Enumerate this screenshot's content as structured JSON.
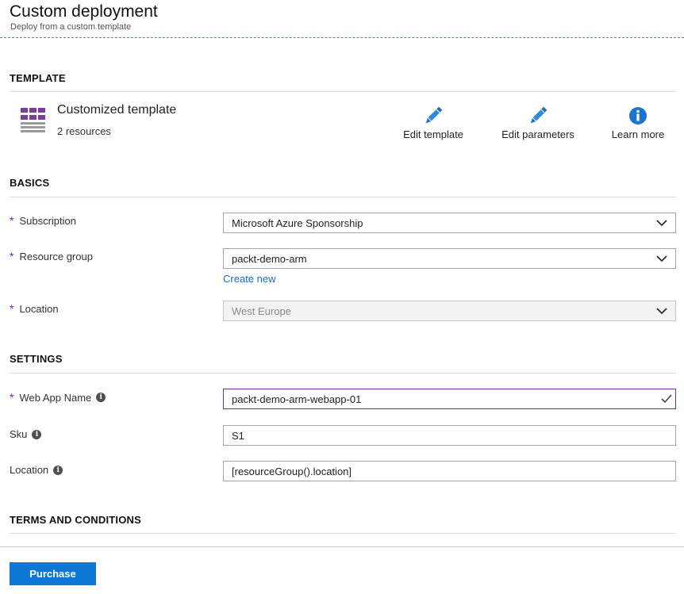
{
  "header": {
    "title": "Custom deployment",
    "subtitle": "Deploy from a custom template"
  },
  "template": {
    "section_title": "TEMPLATE",
    "name": "Customized template",
    "resource_count": "2 resources",
    "icon": "template-grid-icon",
    "actions": [
      {
        "label": "Edit template",
        "icon": "pencil-icon"
      },
      {
        "label": "Edit parameters",
        "icon": "pencil-icon"
      },
      {
        "label": "Learn more",
        "icon": "info-icon"
      }
    ]
  },
  "basics": {
    "section_title": "BASICS",
    "subscription": {
      "label": "Subscription",
      "value": "Microsoft Azure Sponsorship"
    },
    "resource_group": {
      "label": "Resource group",
      "value": "packt-demo-arm",
      "create_new": "Create new"
    },
    "location": {
      "label": "Location",
      "value": "West Europe"
    }
  },
  "settings": {
    "section_title": "SETTINGS",
    "web_app_name": {
      "label": "Web App Name",
      "value": "packt-demo-arm-webapp-01"
    },
    "sku": {
      "label": "Sku",
      "value": "S1"
    },
    "location": {
      "label": "Location",
      "value": "[resourceGroup().location]"
    }
  },
  "terms": {
    "section_title": "TERMS AND CONDITIONS"
  },
  "footer": {
    "purchase_label": "Purchase"
  },
  "colors": {
    "accent_blue": "#0f78d4",
    "required_purple": "#7a1fa2",
    "link_blue": "#1a6dc2"
  }
}
